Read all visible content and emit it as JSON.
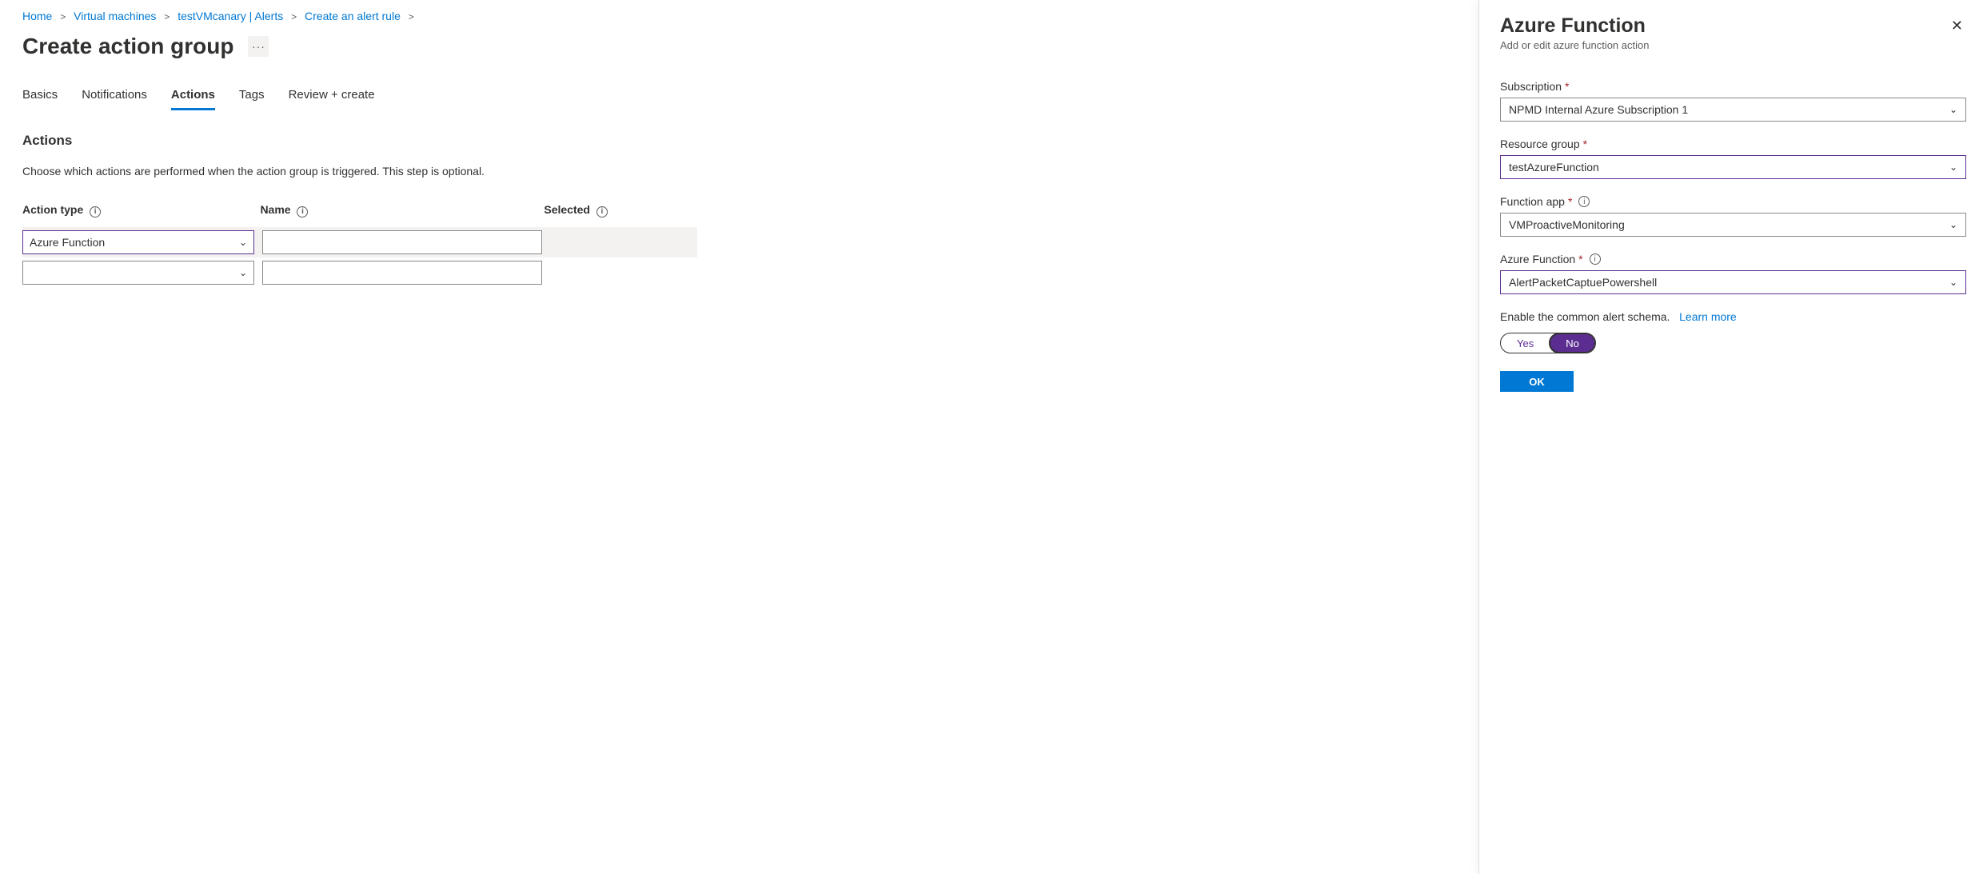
{
  "breadcrumb": {
    "items": [
      "Home",
      "Virtual machines",
      "testVMcanary | Alerts",
      "Create an alert rule"
    ]
  },
  "page_title": "Create action group",
  "tabs": {
    "items": [
      "Basics",
      "Notifications",
      "Actions",
      "Tags",
      "Review + create"
    ],
    "active_index": 2
  },
  "actions_section": {
    "heading": "Actions",
    "description": "Choose which actions are performed when the action group is triggered. This step is optional.",
    "columns": {
      "type": "Action type",
      "name": "Name",
      "selected": "Selected"
    },
    "rows": [
      {
        "type": "Azure Function",
        "name": ""
      },
      {
        "type": "",
        "name": ""
      }
    ]
  },
  "panel": {
    "title": "Azure Function",
    "subtitle": "Add or edit azure function action",
    "fields": {
      "subscription": {
        "label": "Subscription",
        "value": "NPMD Internal Azure Subscription 1"
      },
      "resource_group": {
        "label": "Resource group",
        "value": "testAzureFunction"
      },
      "function_app": {
        "label": "Function app",
        "value": "VMProactiveMonitoring"
      },
      "azure_function": {
        "label": "Azure Function",
        "value": "AlertPacketCaptuePowershell"
      }
    },
    "common_schema": {
      "text": "Enable the common alert schema.",
      "link": "Learn more",
      "yes": "Yes",
      "no": "No"
    },
    "ok": "OK"
  }
}
